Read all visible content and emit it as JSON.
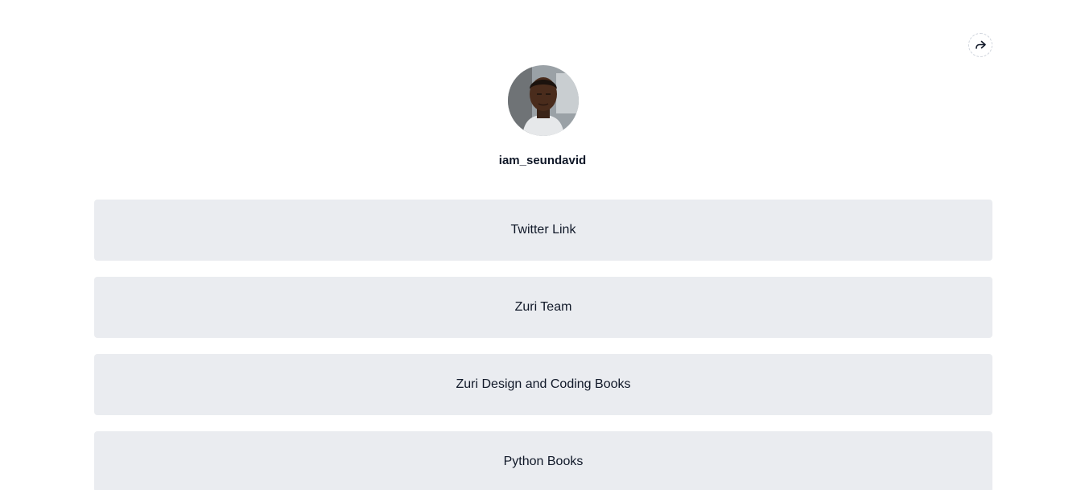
{
  "profile": {
    "username": "iam_seundavid"
  },
  "icons": {
    "share": "share-icon",
    "avatar": "profile-photo"
  },
  "links": [
    {
      "label": "Twitter Link"
    },
    {
      "label": "Zuri Team"
    },
    {
      "label": "Zuri Design and Coding Books"
    },
    {
      "label": "Python Books"
    }
  ],
  "colors": {
    "link_background": "#eaecf0",
    "text": "#101828"
  }
}
